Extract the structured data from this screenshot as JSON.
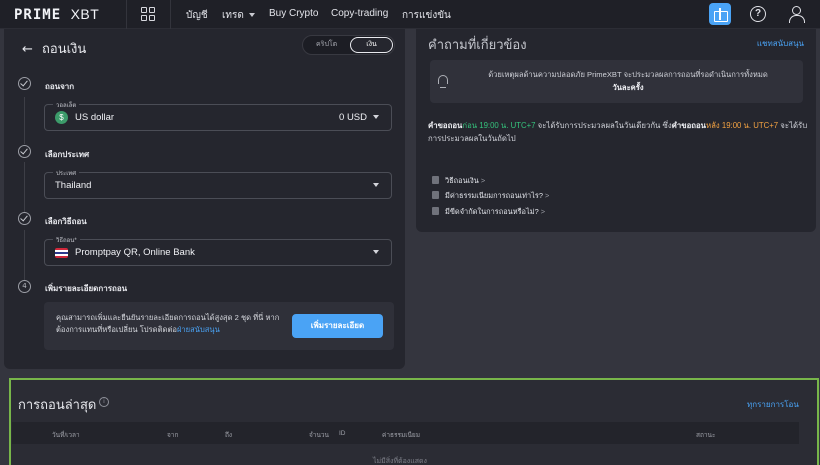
{
  "header": {
    "logo_prime": "PRIME",
    "logo_xbt": "XBT",
    "nav": {
      "account": "บัญชี",
      "trade": "เทรด",
      "buy_crypto": "Buy Crypto",
      "copy_trading": "Copy-trading",
      "competition": "การแข่งขัน"
    },
    "icons": {
      "grid": "apps-grid-icon",
      "gift": "gift-icon",
      "help": "help-icon",
      "user": "user-icon"
    },
    "accent": "#4aa3f5"
  },
  "withdraw": {
    "title": "ถอนเงิน",
    "toggle": {
      "crypto": "คริปโต",
      "fiat": "เงิน"
    },
    "steps": {
      "from": {
        "title": "ถอนจาก",
        "label": "วอลเล็ต",
        "value": "US dollar",
        "currency_icon": "$",
        "amount": "0 USD"
      },
      "country": {
        "title": "เลือกประเทศ",
        "label": "ประเทศ",
        "value": "Thailand"
      },
      "method": {
        "title": "เลือกวิธีถอน",
        "label": "วิธีถอน*",
        "value": "Promptpay QR, Online Bank"
      },
      "details": {
        "number": "4",
        "title": "เพิ่มรายละเอียดการถอน",
        "text_part1": "คุณสามารถเพิ่มและยืนยันรายละเอียดการถอนได้สูงสุด 2 ชุด ที่นี่ หากต้องการแทนที่หรือเปลี่ยน โปรดติดต่อ",
        "text_link": "ฝ่ายสนับสนุน",
        "button": "เพิ่มรายละเอียด"
      }
    }
  },
  "faq": {
    "title": "คำถามที่เกี่ยวข้อง",
    "chat_link": "แชทสนับสนุน",
    "notice_part1": "ด้วยเหตุผลด้านความปลอดภัย PrimeXBT จะประมวลผลการถอนที่รอดำเนินการทั้งหมด",
    "notice_part2": "วันละครั้ง",
    "info": {
      "p1": "คำขอถอน",
      "p2": "ก่อน 19:00 น. UTC+7",
      "p3": " จะได้รับการประมวลผลในวันเดียวกัน ซึ่ง",
      "p4": "คำขอถอน",
      "p5": "หลัง 19:00 น. UTC+7",
      "p6": " จะได้รับการประมวลผลในวันถัดไป"
    },
    "questions": [
      {
        "label": "วิธีถอนเงิน",
        "suffix": ">"
      },
      {
        "label": "มีค่าธรรมเนียมการถอนเท่าไร?",
        "suffix": ">"
      },
      {
        "label": "มีขีดจำกัดในการถอนหรือไม่?",
        "suffix": ">"
      }
    ]
  },
  "history": {
    "title": "การถอนล่าสุด",
    "all_link": "ทุกรายการโอน",
    "columns": {
      "date": "วันที่/เวลา",
      "from": "จาก",
      "to": "ถึง",
      "amount": "จำนวน",
      "id": "ID",
      "fee": "ค่าธรรมเนียม",
      "status": "สถานะ"
    },
    "empty": "ไม่มีสิ่งที่ต้องแสดง"
  }
}
